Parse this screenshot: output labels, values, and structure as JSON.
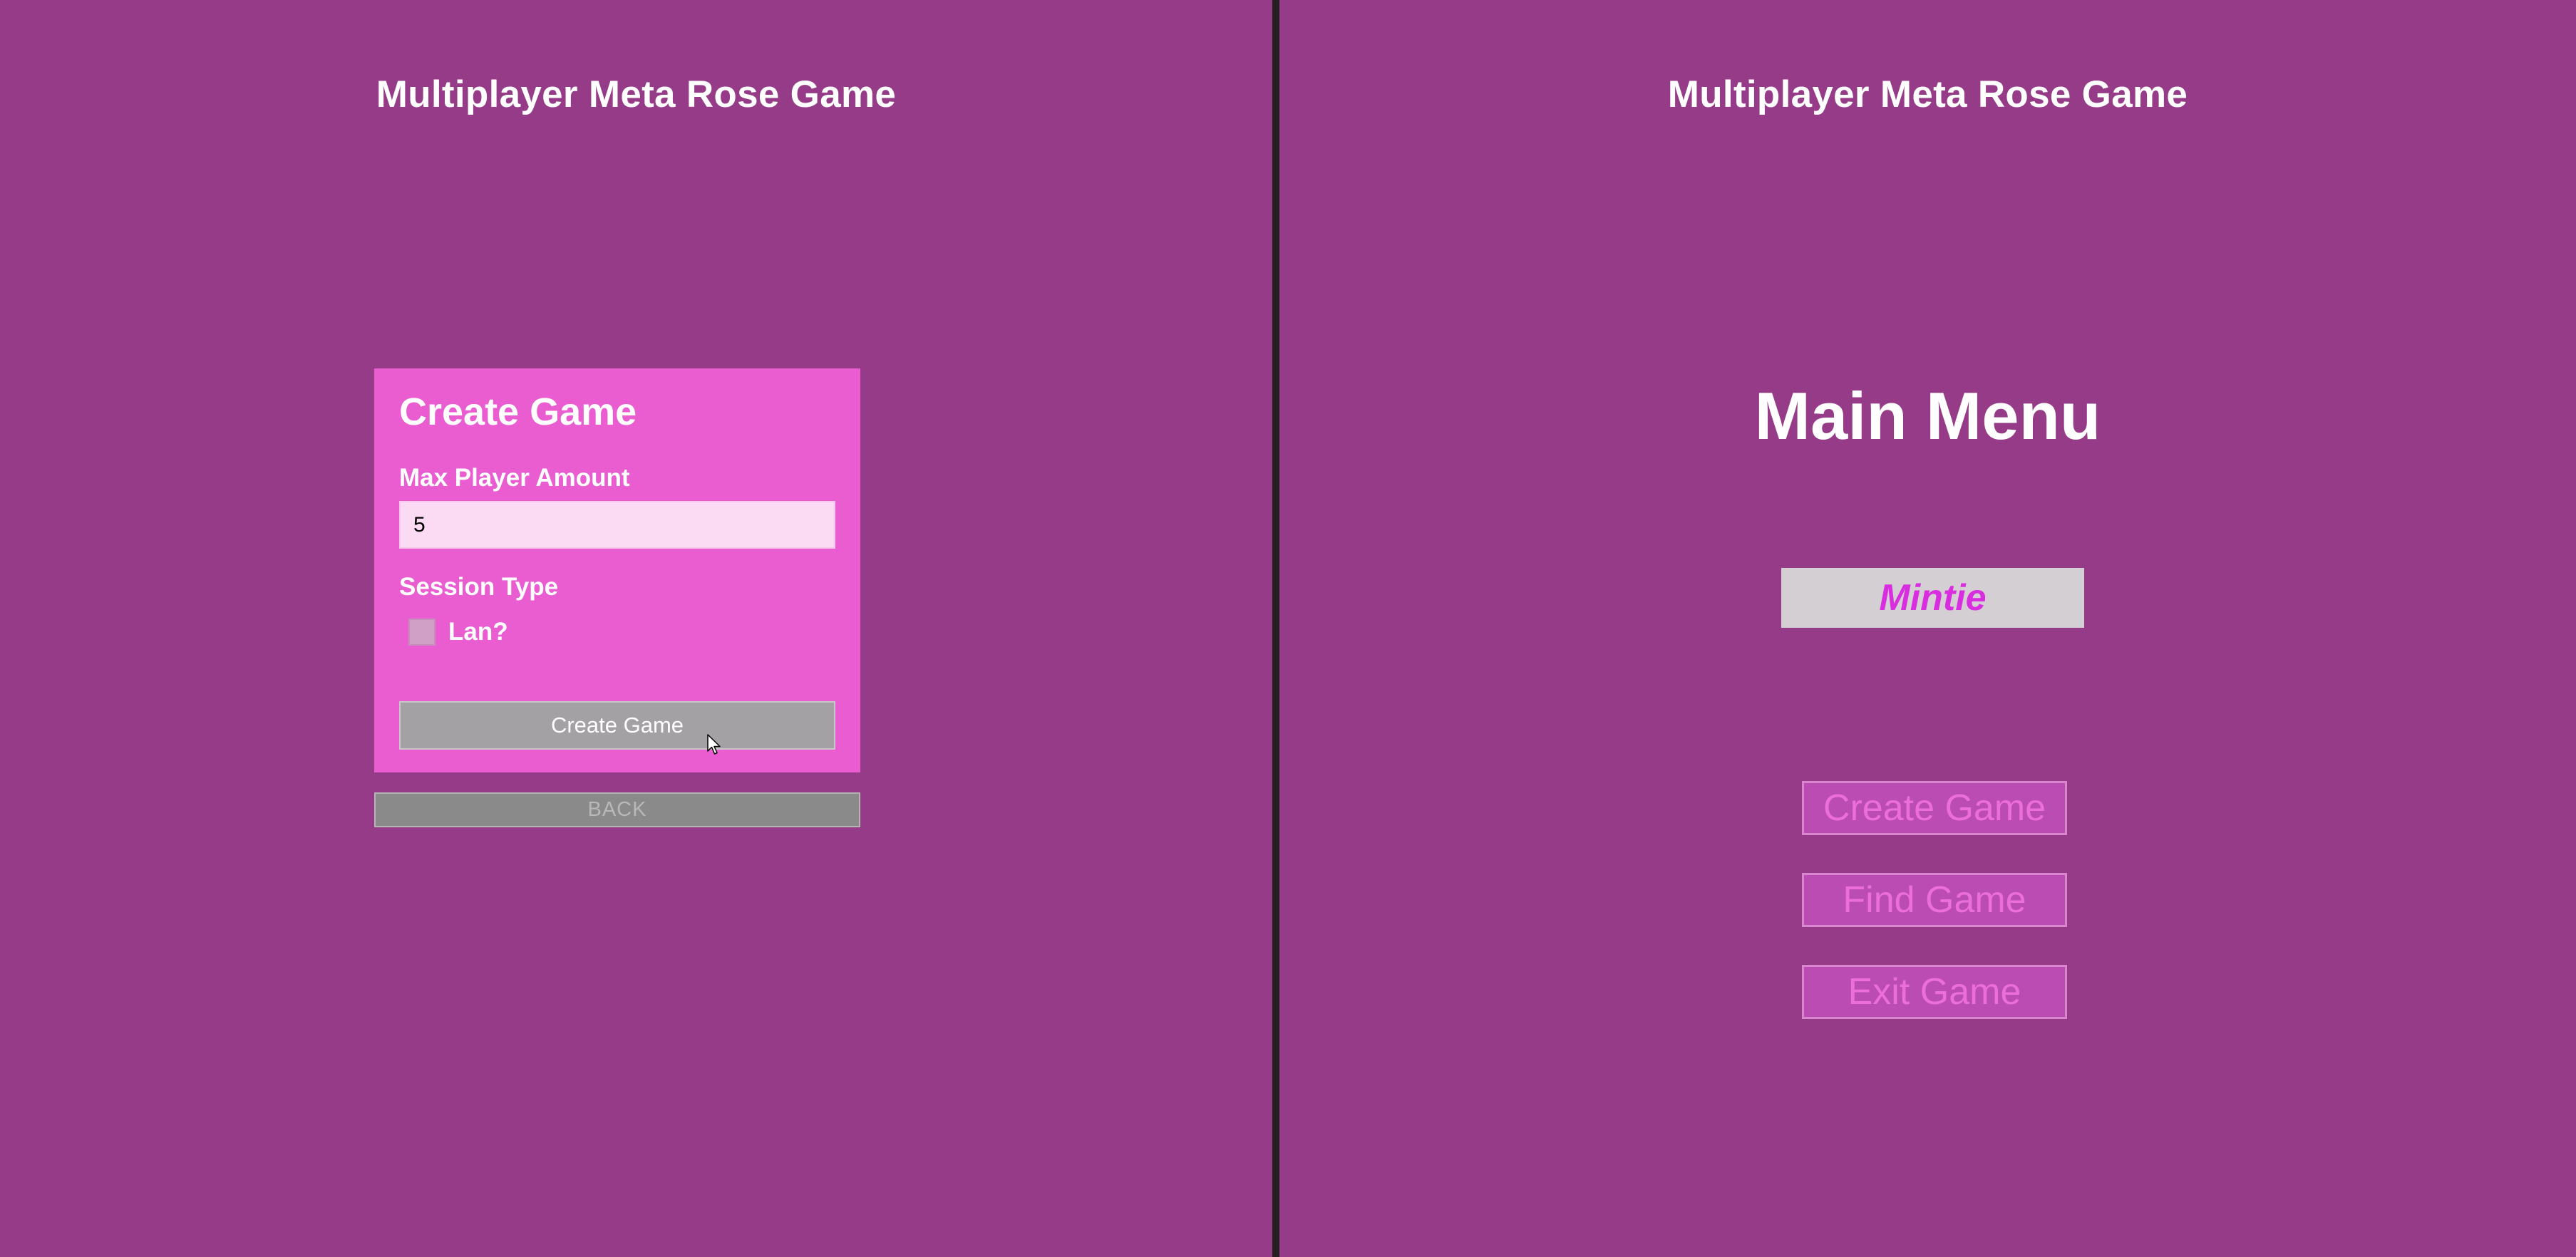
{
  "left": {
    "game_title": "Multiplayer Meta Rose Game",
    "panel": {
      "heading": "Create Game",
      "max_player_label": "Max Player Amount",
      "max_player_value": "5",
      "session_type_label": "Session Type",
      "lan_label": "Lan?",
      "lan_checked": false,
      "create_button": "Create Game"
    },
    "back_button": "BACK"
  },
  "right": {
    "game_title": "Multiplayer Meta Rose Game",
    "heading": "Main Menu",
    "player_name": "Mintie",
    "buttons": {
      "create": "Create Game",
      "find": "Find Game",
      "exit": "Exit Game"
    }
  },
  "colors": {
    "background": "#963b87",
    "panel": "#e95dd1",
    "player_name_text": "#d92ee0",
    "menu_button_text": "#eb6ed9"
  }
}
